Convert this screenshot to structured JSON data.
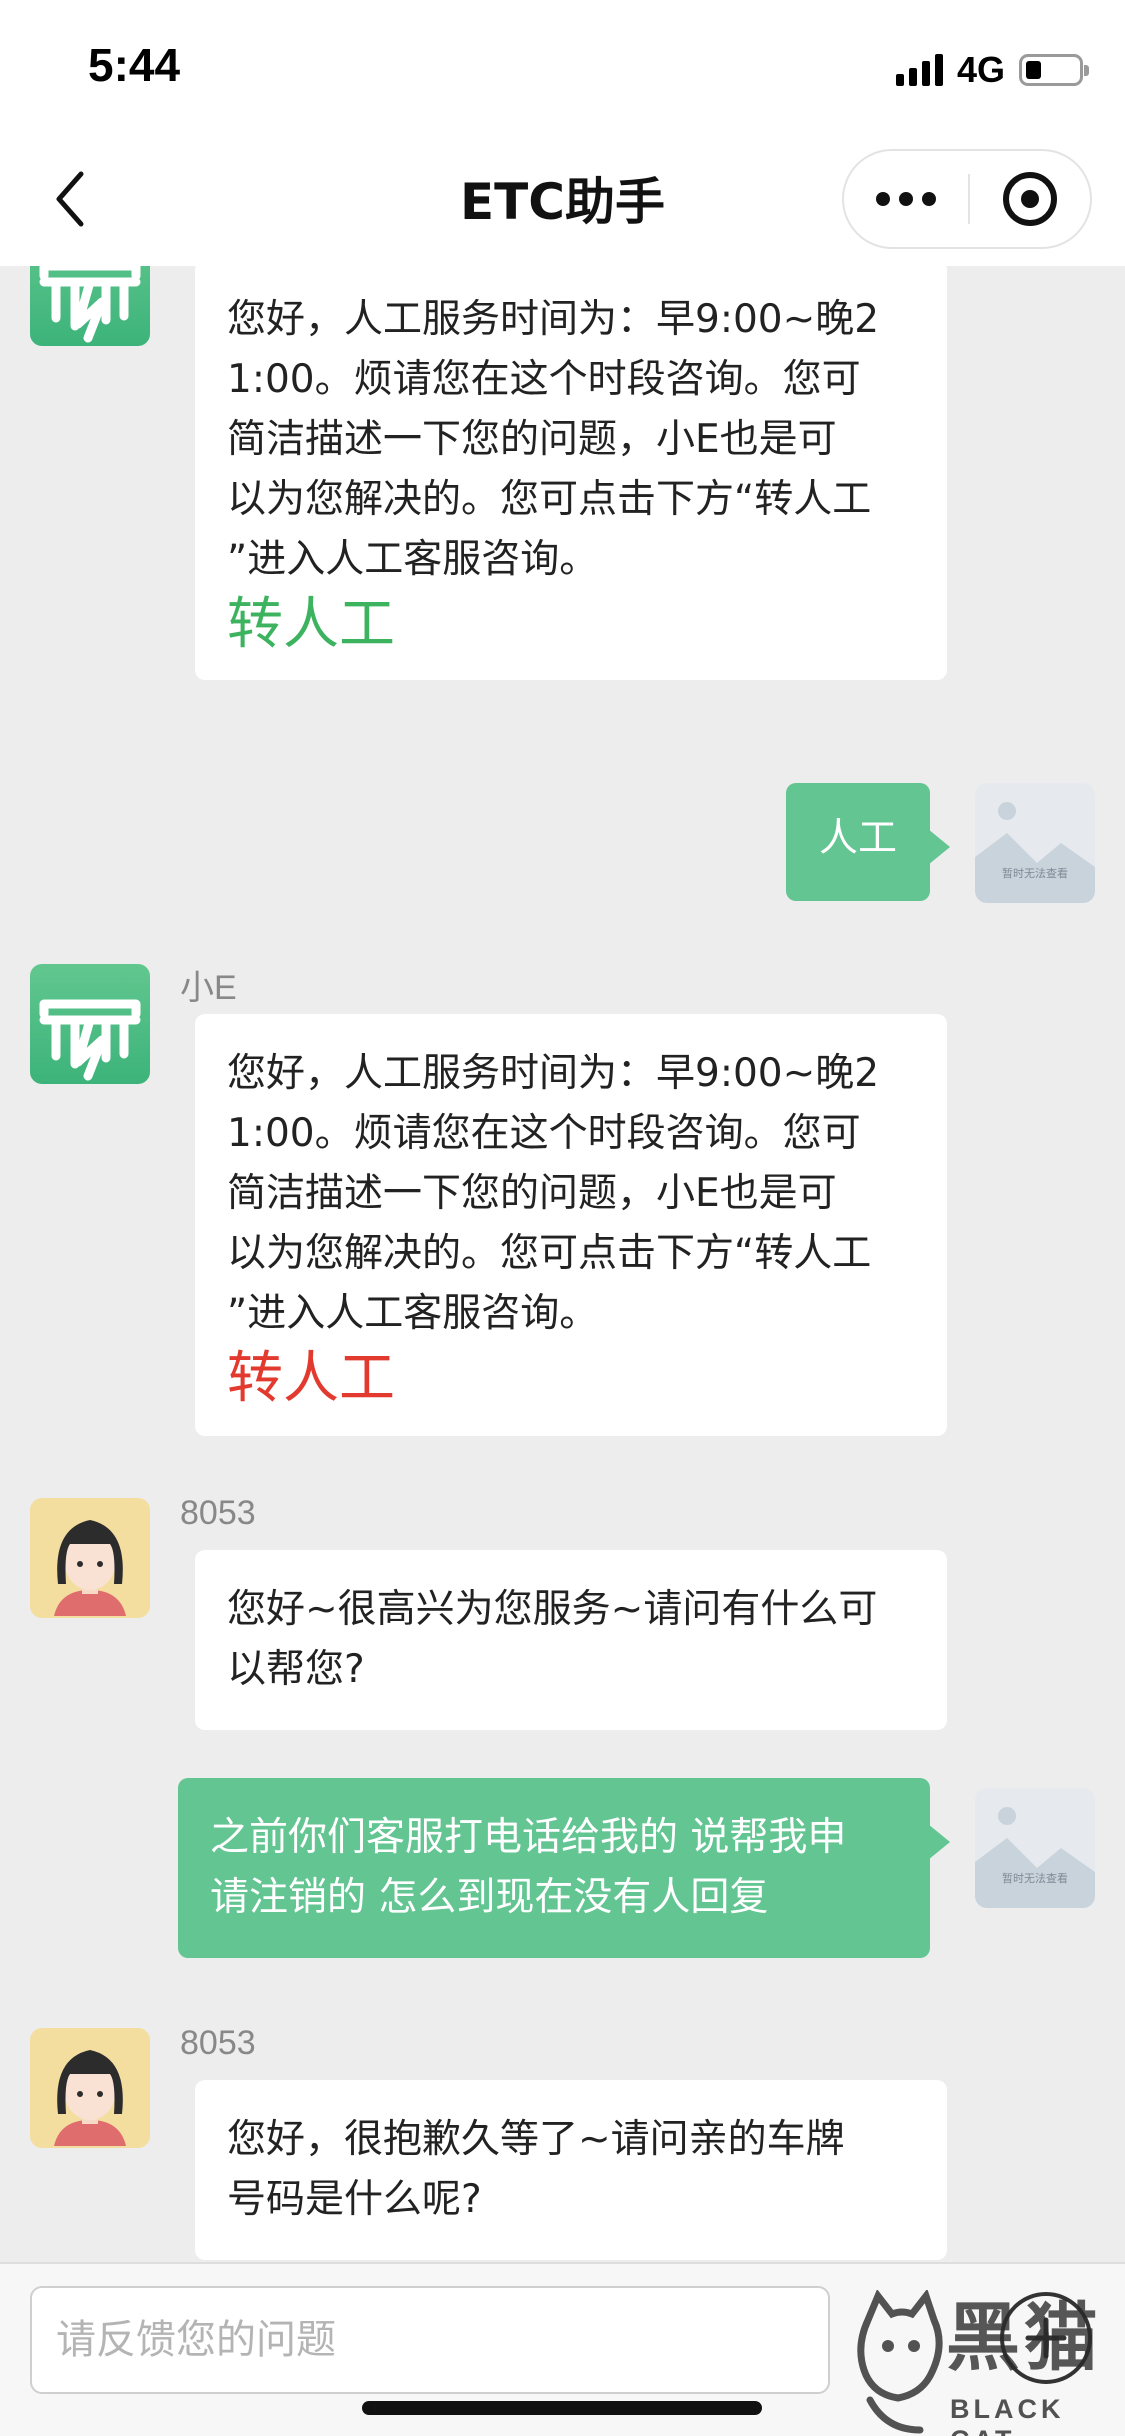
{
  "status_bar": {
    "time": "5:44",
    "network": "4G",
    "battery_level": 0.28
  },
  "nav": {
    "title": "ETC助手",
    "back_icon": "chevron-left-icon",
    "more_icon": "more-dots-icon",
    "close_icon": "target-close-icon"
  },
  "messages": [
    {
      "sender": "小E",
      "avatar": "etc-logo-avatar",
      "lines": [
        "您好，人工服务时间为：早9:00~晚2",
        "1:00。烦请您在这个时段咨询。您可",
        "简洁描述一下您的问题，小E也是可",
        "以为您解决的。您可点击下方“转人工",
        "”进入人工客服咨询。"
      ],
      "link": "转人工",
      "link_color": "#3db35f"
    },
    {
      "sender": "",
      "avatar": "image-unavailable-avatar",
      "avatar_caption": "暂时无法查看",
      "lines": [
        "人工"
      ]
    },
    {
      "sender": "小E",
      "avatar": "etc-logo-avatar",
      "lines": [
        "您好，人工服务时间为：早9:00~晚2",
        "1:00。烦请您在这个时段咨询。您可",
        "简洁描述一下您的问题，小E也是可",
        "以为您解决的。您可点击下方“转人工",
        "”进入人工客服咨询。"
      ],
      "link": "转人工",
      "link_color": "#e23a2e"
    },
    {
      "sender": "8053",
      "avatar": "agent-girl-avatar",
      "lines": [
        "您好~很高兴为您服务~请问有什么可",
        "以帮您?"
      ]
    },
    {
      "sender": "",
      "avatar": "image-unavailable-avatar",
      "avatar_caption": "暂时无法查看",
      "lines": [
        "之前你们客服打电话给我的 说帮我申",
        "请注销的 怎么到现在没有人回复"
      ]
    },
    {
      "sender": "8053",
      "avatar": "agent-girl-avatar",
      "lines": [
        "您好，很抱歉久等了~请问亲的车牌",
        "号码是什么呢?"
      ]
    }
  ],
  "input_bar": {
    "placeholder": "请反馈您的问题",
    "plus_icon": "plus-circle-icon"
  },
  "watermark": {
    "title": "黑猫",
    "subtitle": "BLACK CAT"
  },
  "colors": {
    "bubble_out": "#62c592",
    "bubble_in": "#ffffff",
    "background": "#ededed"
  }
}
